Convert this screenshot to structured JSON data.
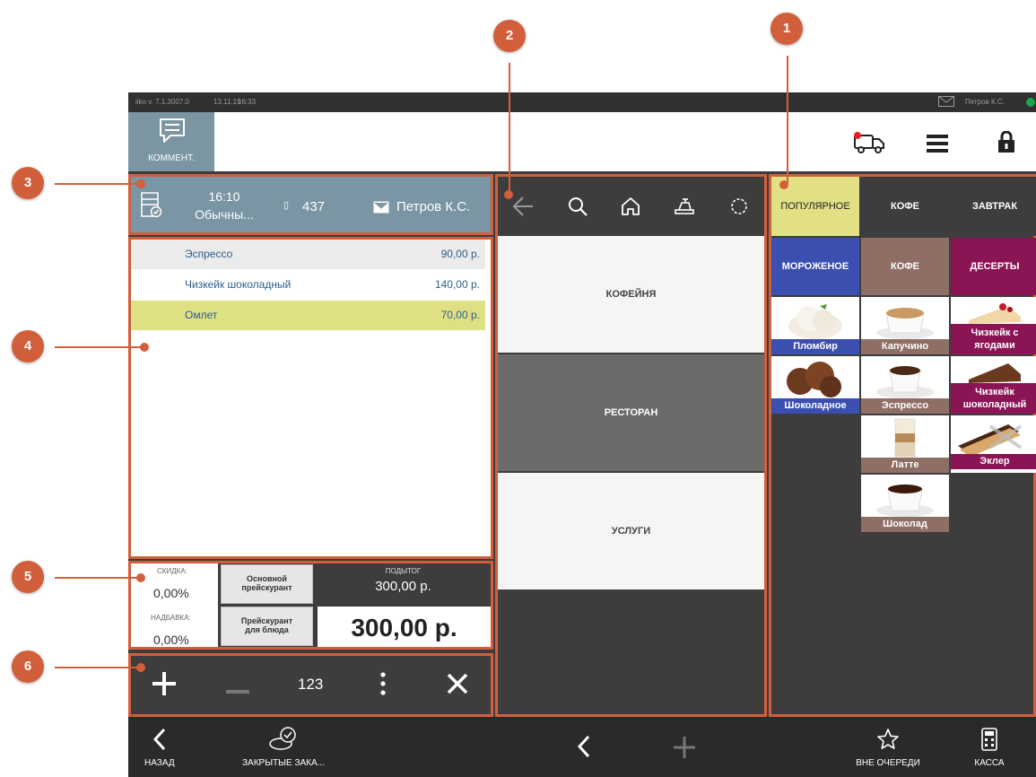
{
  "status_bar": {
    "version": "iiko  v. 7.1.3007.0",
    "date": "13.11.19",
    "time": "16:33",
    "user": "Петров К.С."
  },
  "top_bar": {
    "comment_label": "КОММЕНТ."
  },
  "order_header": {
    "time": "16:10",
    "type": "Обычны...",
    "number": "437",
    "waiter": "Петров К.С."
  },
  "order_items": [
    {
      "name": "Эспрессо",
      "price": "90,00 р."
    },
    {
      "name": "Чизкейк шоколадный",
      "price": "140,00 р."
    },
    {
      "name": "Омлет",
      "price": "70,00 р."
    }
  ],
  "totals": {
    "discount_label": "СКИДКА:",
    "discount_value": "0,00%",
    "markup_label": "НАДБАВКА:",
    "markup_value": "0,00%",
    "price_list_main": [
      "Основной",
      "прейскурант"
    ],
    "price_list_dish": [
      "Прейскурант",
      "для блюда"
    ],
    "subtotal_label": "ПОДЫТОГ",
    "subtotal_value": "300,00 р.",
    "total_value": "300,00 р."
  },
  "qty_bar": {
    "numpad_label": "123"
  },
  "sections": [
    "КОФЕЙНЯ",
    "РЕСТОРАН",
    "УСЛУГИ"
  ],
  "menu_tabs": [
    "ПОПУЛЯРНОЕ",
    "КОФЕ",
    "ЗАВТРАК"
  ],
  "categories": [
    "МОРОЖЕНОЕ",
    "КОФЕ",
    "ДЕСЕРТЫ"
  ],
  "products": {
    "ice_cream": [
      "Пломбир",
      "Шоколадное"
    ],
    "coffee": [
      "Капучино",
      "Эспрессо",
      "Латте",
      "Шоколад"
    ],
    "desserts": [
      "Чизкейк с ягодами",
      "Чизкейк шоколадный",
      "Эклер"
    ]
  },
  "bottom_bar": {
    "back_label": "НАЗАД",
    "closed_orders_label": "ЗАКРЫТЫЕ ЗАКА...",
    "queue_label": "ВНЕ ОЧЕРЕДИ",
    "cashier_label": "КАССА"
  },
  "callouts": [
    "1",
    "2",
    "3",
    "4",
    "5",
    "6"
  ],
  "colors": {
    "accent_orange": "#d25f3b",
    "header_slate": "#7a95a3",
    "popular_tab": "#e1e085",
    "ice_cream": "#3b4fb0",
    "coffee": "#8e6e65",
    "desserts": "#8b1455",
    "selected_row": "#dfe083"
  }
}
